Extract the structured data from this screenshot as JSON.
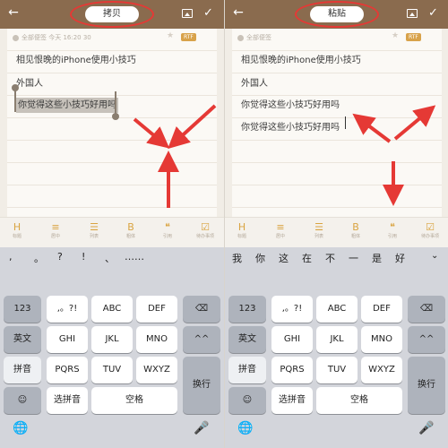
{
  "left": {
    "top_pill": "拷贝",
    "meta": "今天 16:20 30",
    "meta_prefix": "全部便签",
    "rtf": "RTF",
    "lines": [
      "相见恨晚的iPhone使用小技巧",
      "外国人",
      "你觉得这些小技巧好用吗"
    ],
    "suggestions": [
      ",",
      "。",
      "?",
      "!",
      "、",
      "……"
    ]
  },
  "right": {
    "top_pill": "粘贴",
    "meta_prefix": "全部便签",
    "rtf": "RTF",
    "lines": [
      "相见恨晚的iPhone使用小技巧",
      "外国人",
      "你觉得这些小技巧好用吗",
      "你觉得这些小技巧好用吗"
    ],
    "suggestions": [
      "我",
      "你",
      "这",
      "在",
      "不",
      "一",
      "是",
      "好"
    ]
  },
  "format_bar": [
    {
      "icon": "H",
      "label": "标题"
    },
    {
      "icon": "≡",
      "label": "居中"
    },
    {
      "icon": "☰",
      "label": "列表"
    },
    {
      "icon": "B",
      "label": "粗体"
    },
    {
      "icon": "❝",
      "label": "引用"
    },
    {
      "icon": "☑",
      "label": "待办事项"
    }
  ],
  "keyboard": {
    "row1": [
      "123",
      ",。?!",
      "ABC",
      "DEF",
      "⌫"
    ],
    "row2": [
      "英文",
      "GHI",
      "JKL",
      "MNO",
      "^^"
    ],
    "row3": [
      "拼音",
      "PQRS",
      "TUV",
      "WXYZ",
      "换行"
    ],
    "row4": [
      "☺",
      "选拼音",
      "空格"
    ],
    "globe": "🌐",
    "mic": "🎤"
  },
  "colors": {
    "topbar": "#8a6b4e",
    "accent": "#d9a441",
    "annotation": "#e53935",
    "selection": "#c7c2bb"
  }
}
